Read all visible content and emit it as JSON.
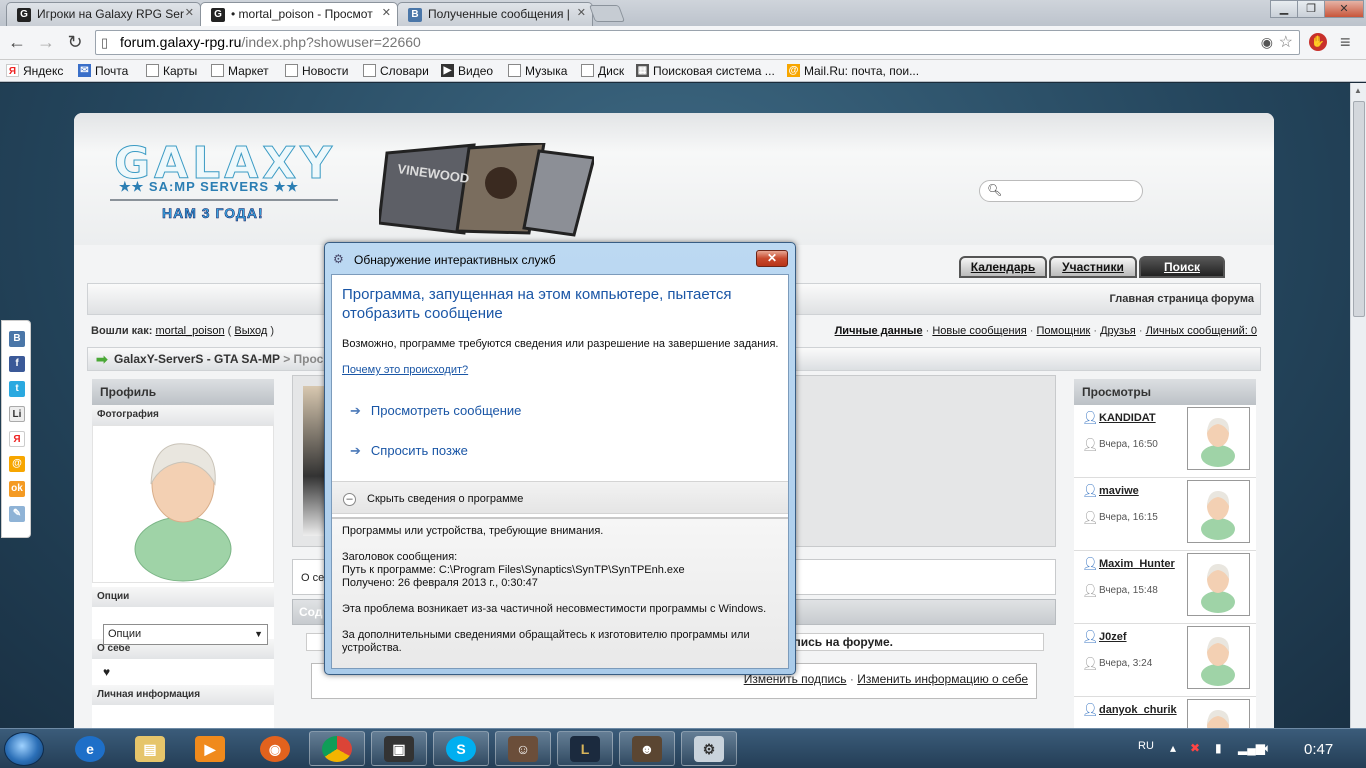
{
  "browser": {
    "tabs": [
      {
        "title": "Игроки на Galaxy RPG Ser",
        "active": false
      },
      {
        "title": "• mortal_poison - Просмот",
        "active": true
      },
      {
        "title": "Полученные сообщения |",
        "active": false
      }
    ],
    "url_host": "forum.galaxy-rpg.ru",
    "url_path": "/index.php?showuser=22660",
    "bookmarks": [
      "Яндекс",
      "Почта",
      "Карты",
      "Маркет",
      "Новости",
      "Словари",
      "Видео",
      "Музыка",
      "Диск",
      "Поисковая система ...",
      "Mail.Ru: почта, пои..."
    ]
  },
  "forum": {
    "logo": "GALAXY",
    "logo_sub": "★★ SA:MP SERVERS ★★",
    "logo_tag": "НАМ 3 ГОДА!",
    "banner_text": "VINEWOOD",
    "nav_tabs": [
      "Календарь",
      "Участники",
      "Поиск"
    ],
    "home_link": "Главная страница форума",
    "logged_as_label": "Вошли как:",
    "username": "mortal_poison",
    "logout": "Выход",
    "user_links": [
      "Личные данные",
      "Новые сообщения",
      "Помощник",
      "Друзья",
      "Личных сообщений: 0"
    ],
    "breadcrumb": "GalaxY-ServerS - GTA SA-MP",
    "breadcrumb_tail": "> Просм",
    "sidebar": {
      "profile_header": "Профиль",
      "photo_label": "Фотография",
      "options_label": "Опции",
      "options_select": "Опции",
      "about_label": "О себе",
      "about_text": "♥",
      "personal_label": "Личная информация"
    },
    "about_tab_partial": "О се",
    "content_tab_partial": "Сод",
    "signature_text": "дпись на форуме.",
    "edit_links": [
      "Изменить подпись",
      "Изменить информацию о себе"
    ],
    "views": {
      "header": "Просмотры",
      "items": [
        {
          "name": "KANDIDAT",
          "time": "Вчера, 16:50"
        },
        {
          "name": "maviwe",
          "time": "Вчера, 16:15"
        },
        {
          "name": "Maxim_Hunter",
          "time": "Вчера, 15:48"
        },
        {
          "name": "J0zef",
          "time": "Вчера, 3:24"
        },
        {
          "name": "danyok_churik",
          "time": ""
        }
      ]
    }
  },
  "dialog": {
    "title": "Обнаружение интерактивных служб",
    "heading": "Программа, запущенная на этом компьютере, пытается отобразить сообщение",
    "text": "Возможно, программе требуются сведения или разрешение на завершение задания.",
    "why_link": "Почему это происходит?",
    "option_view": "Просмотреть сообщение",
    "option_later": "Спросить позже",
    "toggle_label": "Скрыть сведения о программе",
    "details": {
      "line1": "Программы или устройства, требующие внимания.",
      "header_label": "Заголовок сообщения:",
      "path_line": "Путь к программе:  C:\\Program Files\\Synaptics\\SynTP\\SynTPEnh.exe",
      "received_line": "Получено:  26 февраля 2013 г., 0:30:47",
      "problem1": "Эта проблема возникает из-за частичной несовместимости программы с Windows.",
      "problem2": "За дополнительными сведениями обращайтесь к изготовителю программы или устройства."
    }
  },
  "taskbar": {
    "lang": "RU",
    "time": "0:47"
  }
}
